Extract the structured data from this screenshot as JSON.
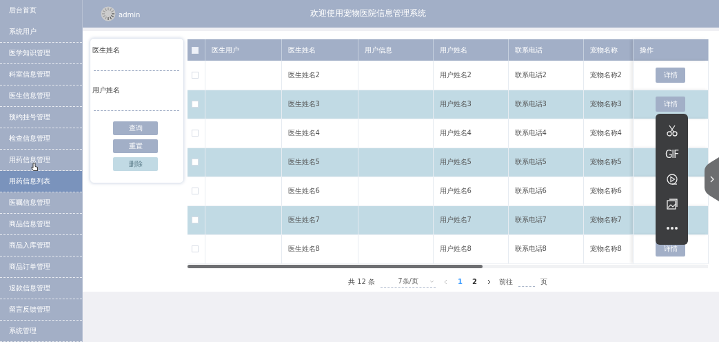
{
  "sidebar": {
    "items": [
      {
        "label": "后台首页",
        "selected": false
      },
      {
        "label": "系统用户",
        "selected": false
      },
      {
        "label": "医学知识管理",
        "selected": false
      },
      {
        "label": "科室信息管理",
        "selected": false
      },
      {
        "label": "医生信息管理",
        "selected": false
      },
      {
        "label": "预约挂号管理",
        "selected": false
      },
      {
        "label": "检查信息管理",
        "selected": false
      },
      {
        "label": "用药信息管理",
        "selected": false
      },
      {
        "label": "用药信息列表",
        "selected": true
      },
      {
        "label": "医嘱信息管理",
        "selected": false
      },
      {
        "label": "商品信息管理",
        "selected": false
      },
      {
        "label": "商品入库管理",
        "selected": false
      },
      {
        "label": "商品订单管理",
        "selected": false
      },
      {
        "label": "退款信息管理",
        "selected": false
      },
      {
        "label": "留言反馈管理",
        "selected": false
      },
      {
        "label": "系统管理",
        "selected": false
      }
    ]
  },
  "header": {
    "username": "admin",
    "title": "欢迎使用宠物医院信息管理系统"
  },
  "search": {
    "fields": [
      {
        "label": "医生姓名"
      },
      {
        "label": "用户姓名"
      }
    ],
    "buttons": [
      {
        "label": "查询",
        "disabled": false
      },
      {
        "label": "重置",
        "disabled": false
      },
      {
        "label": "删除",
        "disabled": true
      }
    ]
  },
  "table": {
    "select_all_checked": false,
    "columns": [
      {
        "label": "医生用户"
      },
      {
        "label": "医生姓名"
      },
      {
        "label": "用户信息"
      },
      {
        "label": "用户姓名"
      },
      {
        "label": "联系电话"
      },
      {
        "label": "宠物名称"
      },
      {
        "label": "操作"
      }
    ],
    "rows": [
      {
        "checked": false,
        "doctor_name": "医生姓名2",
        "user_name": "用户姓名2",
        "phone": "联系电话2",
        "pet_name": "宠物名称2",
        "action": "详情"
      },
      {
        "checked": false,
        "doctor_name": "医生姓名3",
        "user_name": "用户姓名3",
        "phone": "联系电话3",
        "pet_name": "宠物名称3",
        "action": "详情"
      },
      {
        "checked": false,
        "doctor_name": "医生姓名4",
        "user_name": "用户姓名4",
        "phone": "联系电话4",
        "pet_name": "宠物名称4"
      },
      {
        "checked": false,
        "doctor_name": "医生姓名5",
        "user_name": "用户姓名5",
        "phone": "联系电话5",
        "pet_name": "宠物名称5"
      },
      {
        "checked": false,
        "doctor_name": "医生姓名6",
        "user_name": "用户姓名6",
        "phone": "联系电话6",
        "pet_name": "宠物名称6"
      },
      {
        "checked": false,
        "doctor_name": "医生姓名7",
        "user_name": "用户姓名7",
        "phone": "联系电话7",
        "pet_name": "宠物名称7"
      },
      {
        "checked": false,
        "doctor_name": "医生姓名8",
        "user_name": "用户姓名8",
        "phone": "联系电话8",
        "pet_name": "宠物名称8",
        "action": "详情"
      }
    ]
  },
  "pagination": {
    "total": "共 12 条",
    "page_size": "7条/页",
    "pages": [
      {
        "label": "1",
        "selected": true
      },
      {
        "label": "2",
        "selected": false
      }
    ],
    "goto_label": "前往",
    "page_suffix": "页"
  },
  "capture_toolbar": {
    "items": [
      {
        "kind": "scissors"
      },
      {
        "kind": "gif",
        "label": "GIF"
      },
      {
        "kind": "record"
      },
      {
        "kind": "image"
      },
      {
        "kind": "more"
      }
    ]
  }
}
